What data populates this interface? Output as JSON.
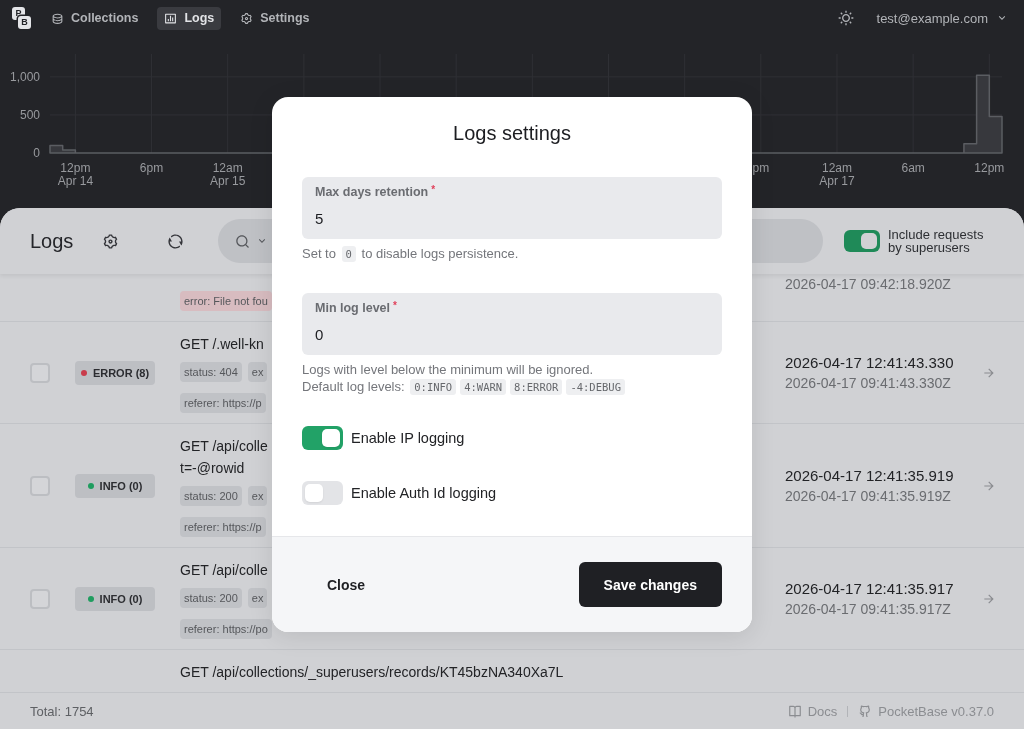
{
  "nav": {
    "logo": "PB",
    "items": [
      {
        "label": "Collections",
        "kind": "database",
        "selected": false
      },
      {
        "label": "Logs",
        "kind": "chart",
        "selected": true
      },
      {
        "label": "Settings",
        "kind": "gear",
        "selected": false
      }
    ],
    "user": "test@example.com"
  },
  "chart": {
    "chart_data": {
      "type": "area",
      "grid": true,
      "x": [
        "2026-04-14T10:00",
        "2026-04-14T11:00",
        "2026-04-14T11:00",
        "2026-04-14T12:00",
        "2026-04-14T12:00",
        "2026-04-17T10:00",
        "2026-04-17T10:00",
        "2026-04-17T11:00",
        "2026-04-17T11:00",
        "2026-04-17T12:00",
        "2026-04-17T12:00",
        "2026-04-17T13:00"
      ],
      "values": [
        100,
        100,
        40,
        40,
        0,
        0,
        120,
        120,
        1020,
        1020,
        480,
        480
      ],
      "xlim": [
        "2026-04-14T10:00",
        "2026-04-17T13:00"
      ],
      "ylim": [
        0,
        1300
      ],
      "xticks": [
        {
          "value": "2026-04-14T12:00",
          "label": "12pm\nApr 14"
        },
        {
          "value": "2026-04-14T18:00",
          "label": "6pm"
        },
        {
          "value": "2026-04-15T00:00",
          "label": "12am\nApr 15"
        },
        {
          "value": "2026-04-16T18:00",
          "label": "pm"
        },
        {
          "value": "2026-04-17T00:00",
          "label": "12am\nApr 17"
        },
        {
          "value": "2026-04-17T06:00",
          "label": "6am"
        },
        {
          "value": "2026-04-17T12:00",
          "label": "12pm"
        }
      ],
      "yticks": [
        0,
        500,
        {
          "value": 1000,
          "label": "1,000"
        }
      ]
    }
  },
  "panel": {
    "title": "Logs",
    "superusers_filter": {
      "label": "Include requests by superusers",
      "on": true
    }
  },
  "rows": [
    {
      "tag_lines": [
        [
          {
            "text": "error: File not fou",
            "kind": "error"
          }
        ]
      ],
      "time_utc": "2026-04-17 09:42:18.920Z"
    },
    {
      "checked": false,
      "status": {
        "label": "ERROR (8)",
        "color": "#c93c4b"
      },
      "request": [
        "GET /.well-kn"
      ],
      "tag_lines": [
        [
          {
            "text": "status: 404",
            "kind": "plain"
          },
          {
            "text": "ex",
            "kind": "plain"
          }
        ],
        [
          {
            "text": "referer: https://p",
            "kind": "plain"
          }
        ]
      ],
      "time": "2026-04-17 12:41:43.330",
      "time_utc": "2026-04-17 09:41:43.330Z"
    },
    {
      "checked": false,
      "status": {
        "label": "INFO (0)",
        "color": "#1f9d5f"
      },
      "request": [
        "GET /api/colle",
        "t=-@rowid"
      ],
      "tag_lines": [
        [
          {
            "text": "status: 200",
            "kind": "plain"
          },
          {
            "text": "ex",
            "kind": "plain"
          }
        ],
        [
          {
            "text": "referer: https://p",
            "kind": "plain"
          }
        ]
      ],
      "time": "2026-04-17 12:41:35.919",
      "time_utc": "2026-04-17 09:41:35.919Z"
    },
    {
      "checked": false,
      "status": {
        "label": "INFO (0)",
        "color": "#1f9d5f"
      },
      "request": [
        "GET /api/colle"
      ],
      "tag_lines": [
        [
          {
            "text": "status: 200",
            "kind": "plain"
          },
          {
            "text": "ex",
            "kind": "plain"
          }
        ],
        [
          {
            "text": "referer: https://po",
            "kind": "plain"
          }
        ]
      ],
      "time": "2026-04-17 12:41:35.917",
      "time_utc": "2026-04-17 09:41:35.917Z"
    },
    {
      "request": [
        "GET /api/collections/_superusers/records/KT45bzNA340Xa7L"
      ]
    }
  ],
  "footer": {
    "total": "Total: 1754",
    "links": [
      {
        "label": "Docs",
        "kind": "book"
      },
      {
        "label": "PocketBase v0.37.0",
        "kind": "github"
      }
    ]
  },
  "modal": {
    "title": "Logs settings",
    "fields": [
      {
        "label": "Max days retention",
        "mark": "*",
        "value": "5",
        "help": [
          [
            {
              "kind": "text",
              "text": "Set to "
            },
            {
              "kind": "code",
              "text": "0"
            },
            {
              "kind": "text",
              "text": " to disable logs persistence."
            }
          ]
        ]
      },
      {
        "label": "Min log level",
        "mark": "*",
        "value": "0",
        "help": [
          [
            {
              "kind": "text",
              "text": "Logs with level below the minimum will be ignored."
            }
          ],
          [
            {
              "kind": "text",
              "text": "Default log levels: "
            },
            {
              "kind": "code",
              "text": "0:INFO"
            },
            {
              "kind": "code",
              "text": "4:WARN"
            },
            {
              "kind": "code",
              "text": "8:ERROR"
            },
            {
              "kind": "code",
              "text": "-4:DEBUG"
            }
          ]
        ]
      }
    ],
    "toggles": [
      {
        "label": "Enable IP logging",
        "on": true
      },
      {
        "label": "Enable Auth Id logging",
        "on": false
      }
    ],
    "buttons": [
      {
        "label": "Close",
        "kind": "secondary"
      },
      {
        "label": "Save changes",
        "kind": "primary"
      }
    ]
  }
}
